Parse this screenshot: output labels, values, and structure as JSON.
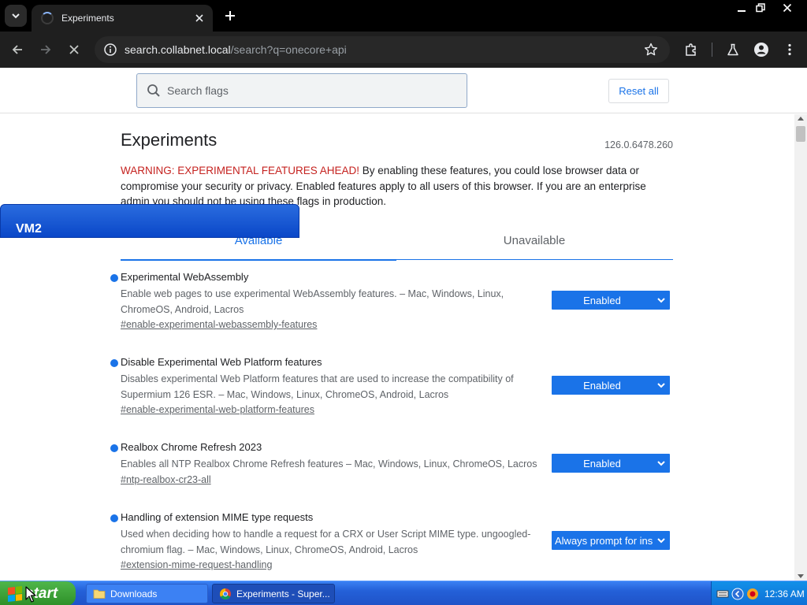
{
  "browser": {
    "tab_title": "Experiments",
    "url_host": "search.collabnet.local",
    "url_path": "/search?q=onecore+api"
  },
  "header": {
    "search_placeholder": "Search flags",
    "reset_label": "Reset all"
  },
  "page": {
    "title": "Experiments",
    "version": "126.0.6478.260",
    "warning_prefix": "WARNING: EXPERIMENTAL FEATURES AHEAD!",
    "warning_body": " By enabling these features, you could lose browser data or compromise your security or privacy. Enabled features apply to all users of this browser. If you are an enterprise admin you should not be using these flags in production.",
    "tabs": [
      {
        "label": "Available"
      },
      {
        "label": "Unavailable"
      }
    ]
  },
  "flags": [
    {
      "name": "Experimental WebAssembly",
      "description": "Enable web pages to use experimental WebAssembly features. – Mac, Windows, Linux, ChromeOS, Android, Lacros",
      "link": "#enable-experimental-webassembly-features",
      "value": "Enabled"
    },
    {
      "name": "Disable Experimental Web Platform features",
      "description": "Disables experimental Web Platform features that are used to increase the compatibility of Supermium 126 ESR. – Mac, Windows, Linux, ChromeOS, Android, Lacros",
      "link": "#enable-experimental-web-platform-features",
      "value": "Enabled"
    },
    {
      "name": "Realbox Chrome Refresh 2023",
      "description": "Enables all NTP Realbox Chrome Refresh features – Mac, Windows, Linux, ChromeOS, Lacros",
      "link": "#ntp-realbox-cr23-all",
      "value": "Enabled"
    },
    {
      "name": "Handling of extension MIME type requests",
      "description": "Used when deciding how to handle a request for a CRX or User Script MIME type. ungoogled-chromium flag. – Mac, Windows, Linux, ChromeOS, Android, Lacros",
      "link": "#extension-mime-request-handling",
      "value": "Always prompt for ins"
    }
  ],
  "overlay": {
    "label": "VM2"
  },
  "taskbar": {
    "start_label": "start",
    "tasks": [
      {
        "label": "Downloads"
      },
      {
        "label": "Experiments - Super..."
      }
    ],
    "clock": "12:36 AM"
  },
  "colors": {
    "accent": "#1a73e8",
    "warning": "#c5221f",
    "taskbar": "#245edb",
    "start": "#3c9a36"
  },
  "icons": [
    "tab-search-icon",
    "spinner-icon",
    "close-icon",
    "plus-icon",
    "minimize-icon",
    "restore-icon",
    "back-icon",
    "forward-icon",
    "stop-icon",
    "site-info-icon",
    "star-icon",
    "extensions-icon",
    "labs-icon",
    "profile-icon",
    "menu-icon",
    "search-icon",
    "chevron-down-icon",
    "folder-icon",
    "chrome-icon",
    "keyboard-icon",
    "chevron-left-icon",
    "shield-icon"
  ]
}
